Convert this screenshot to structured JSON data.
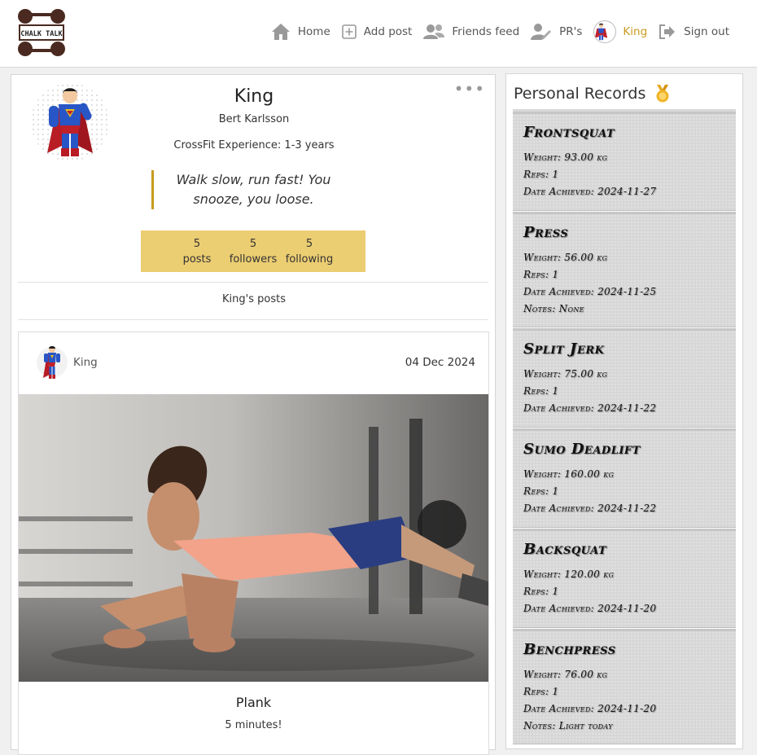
{
  "brand": {
    "logo_text": "CHALK TALK"
  },
  "nav": {
    "home": "Home",
    "add_post": "Add post",
    "friends_feed": "Friends feed",
    "prs": "PR's",
    "profile": "King",
    "sign_out": "Sign out"
  },
  "profile": {
    "username": "King",
    "full_name": "Bert Karlsson",
    "experience": "CrossFit Experience: 1-3 years",
    "quote": "Walk slow, run fast! You snooze, you loose.",
    "stats": {
      "posts_count": "5",
      "posts_label": "posts",
      "followers_count": "5",
      "followers_label": "followers",
      "following_count": "5",
      "following_label": "following"
    },
    "posts_heading": "King's posts"
  },
  "post": {
    "username": "King",
    "date": "04 Dec 2024",
    "title": "Plank",
    "text": "5 minutes!"
  },
  "records": {
    "heading": "Personal Records",
    "items": [
      {
        "lift": "Frontsquat",
        "weight": "Weight: 93.00 kg",
        "reps": "Reps: 1",
        "date": "Date Achieved: 2024-11-27"
      },
      {
        "lift": "Press",
        "weight": "Weight: 56.00 kg",
        "reps": "Reps: 1",
        "date": "Date Achieved: 2024-11-25",
        "notes": "Notes: None"
      },
      {
        "lift": "Split Jerk",
        "weight": "Weight: 75.00 kg",
        "reps": "Reps: 1",
        "date": "Date Achieved: 2024-11-22"
      },
      {
        "lift": "Sumo Deadlift",
        "weight": "Weight: 160.00 kg",
        "reps": "Reps: 1",
        "date": "Date Achieved: 2024-11-22"
      },
      {
        "lift": "Backsquat",
        "weight": "Weight: 120.00 kg",
        "reps": "Reps: 1",
        "date": "Date Achieved: 2024-11-20"
      },
      {
        "lift": "Benchpress",
        "weight": "Weight: 76.00 kg",
        "reps": "Reps: 1",
        "date": "Date Achieved: 2024-11-20",
        "notes": "Notes: Light today"
      }
    ]
  },
  "colors": {
    "accent": "#c89a1e",
    "stats_bg": "#ebcd72",
    "pr_card_bg": "#d6d6d6"
  }
}
